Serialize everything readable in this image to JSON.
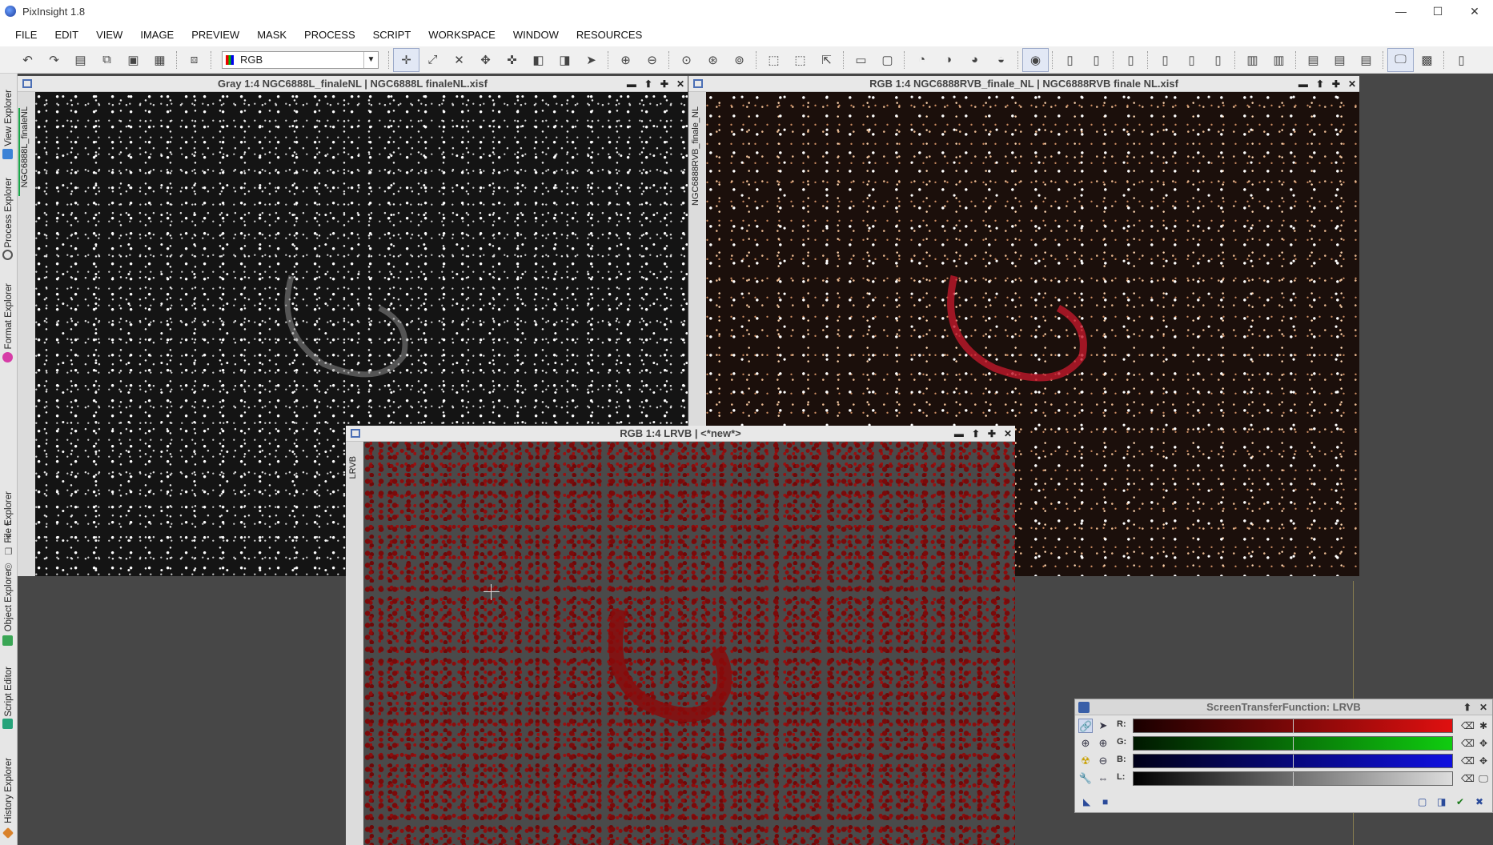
{
  "app": {
    "title": "PixInsight 1.8",
    "win_controls": [
      "—",
      "☐",
      "✕"
    ]
  },
  "menu": [
    "FILE",
    "EDIT",
    "VIEW",
    "IMAGE",
    "PREVIEW",
    "MASK",
    "PROCESS",
    "SCRIPT",
    "WORKSPACE",
    "WINDOW",
    "RESOURCES"
  ],
  "toolbar": {
    "channel_select": "RGB"
  },
  "sidebar": {
    "tabs": [
      "View Explorer",
      "Process Explorer",
      "Format Explorer",
      "File Explorer",
      "Object Explorer",
      "Script Editor",
      "History Explorer"
    ],
    "colors": {
      "view": "#3b82d6",
      "process": "#555555",
      "format": "#d63ca7",
      "file": "#c9a253",
      "object": "#3aa655",
      "script": "#26a37a",
      "history": "#d9822b"
    }
  },
  "windows": {
    "gray": {
      "title": "Gray 1:4 NGC6888L_finaleNL | NGC6888L finaleNL.xisf",
      "tab": "NGC6888L_finaleNL"
    },
    "rgb": {
      "title": "RGB 1:4 NGC6888RVB_finale_NL | NGC6888RVB finale NL.xisf",
      "tab": "NGC6888RVB_finale_NL"
    },
    "lrvb": {
      "title": "RGB 1:4 LRVB | <*new*>",
      "tab": "LRVB"
    }
  },
  "stf": {
    "title": "ScreenTransferFunction: LRVB",
    "channels": [
      {
        "label": "R:",
        "from": "#1a0000",
        "to": "#e01010"
      },
      {
        "label": "G:",
        "from": "#001800",
        "to": "#10cc10"
      },
      {
        "label": "B:",
        "from": "#000018",
        "to": "#1010e0"
      },
      {
        "label": "L:",
        "from": "#000000",
        "to": "#dddddd"
      }
    ]
  }
}
